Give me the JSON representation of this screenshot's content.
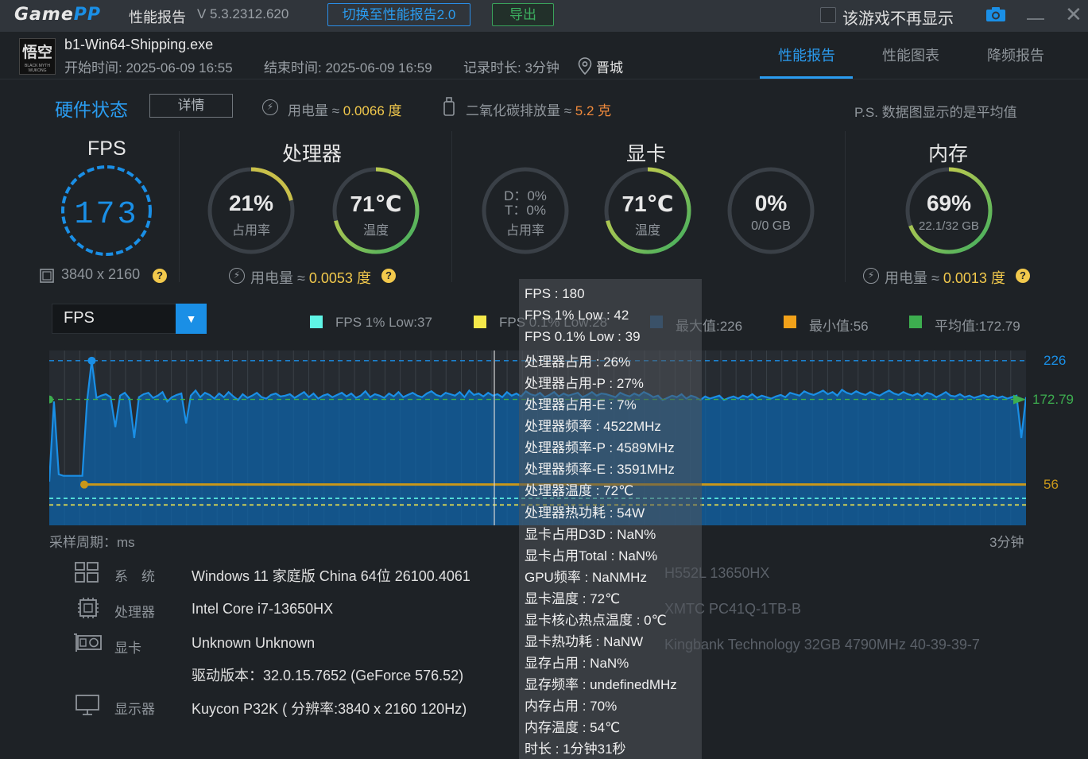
{
  "titlebar": {
    "logo_game": "Game",
    "logo_pp": "PP",
    "title": "性能报告",
    "version": "V 5.3.2312.620",
    "switch_button": "切换至性能报告2.0",
    "export_button": "导出",
    "no_show_label": "该游戏不再显示",
    "close_glyph": "✕"
  },
  "game": {
    "name": "b1-Win64-Shipping.exe",
    "start_time": "开始时间: 2025-06-09 16:55",
    "end_time": "结束时间: 2025-06-09 16:59",
    "duration": "记录时长: 3分钟",
    "city": "晋城",
    "icon_text": "悟空",
    "icon_subtext": "BLACK MYTH WUKONG"
  },
  "tabs": [
    "性能报告",
    "性能图表",
    "降频报告"
  ],
  "hardware": {
    "title": "硬件状态",
    "detail_button": "详情",
    "power_label": "用电量 ≈ ",
    "power_value": "0.0066 度",
    "co2_label": "二氧化碳排放量 ≈ ",
    "co2_value": "5.2 克",
    "ps_note": "P.S. 数据图显示的是平均值",
    "fps": {
      "title": "FPS",
      "value": "173",
      "resolution": "3840 x 2160"
    },
    "cpu": {
      "title": "处理器",
      "usage": "21%",
      "usage_label": "占用率",
      "usage_fraction": 0.21,
      "temp": "71℃",
      "temp_label": "温度",
      "temp_fraction": 0.71,
      "power_label": "用电量 ≈ ",
      "power_value": "0.0053 度"
    },
    "gpu": {
      "title": "显卡",
      "d_usage": "D：0%",
      "t_usage": "T：0%",
      "usage_label": "占用率",
      "temp": "71℃",
      "temp_label": "温度",
      "temp_fraction": 0.71,
      "vram": "0%",
      "vram_label": "0/0 GB"
    },
    "memory": {
      "title": "内存",
      "usage": "69%",
      "usage_label": "22.1/32 GB",
      "usage_fraction": 0.69,
      "power_label": "用电量 ≈ ",
      "power_value": "0.0013 度"
    },
    "help_glyph": "?"
  },
  "chart_panel": {
    "select_value": "FPS",
    "legend": [
      {
        "label": "FPS 1% Low:37",
        "color": "#5ff5e6"
      },
      {
        "label": "FPS 0.1% Low:28",
        "color": "#f5e94a"
      },
      {
        "label": "最大值:226",
        "color": "#1f4f7a"
      },
      {
        "label": "最小值:56",
        "color": "#f2a21a"
      },
      {
        "label": "平均值:172.79",
        "color": "#3dae4f"
      }
    ],
    "x_left_label": "采样周期：ms",
    "x_right_label": "3分钟",
    "max_label": "226",
    "avg_label": "172.79",
    "min_label": "56"
  },
  "chart_data": {
    "type": "area",
    "series": [
      {
        "values": [
          60,
          170,
          70,
          68,
          68,
          68,
          68,
          68,
          170,
          226,
          175,
          178,
          180,
          176,
          135,
          178,
          182,
          174,
          120,
          176,
          180,
          182,
          175,
          178,
          183,
          170,
          176,
          179,
          181,
          140,
          178,
          185,
          176,
          182,
          179,
          174,
          181,
          176,
          183,
          177,
          172,
          180,
          175,
          178,
          182,
          176,
          174,
          179,
          181,
          177,
          178,
          180,
          175,
          179,
          183,
          176,
          181,
          174,
          178,
          180,
          176,
          179,
          182,
          177,
          181,
          175,
          178,
          184,
          176,
          180,
          178,
          175,
          181,
          177,
          183,
          176,
          179,
          182,
          178,
          176,
          181,
          184,
          179,
          177,
          182,
          180,
          178,
          183,
          176,
          185,
          179,
          181,
          177,
          182,
          178,
          180,
          176,
          183,
          178,
          181,
          177,
          184,
          180,
          178,
          182,
          176,
          179,
          183,
          177,
          181,
          178,
          180,
          182,
          176,
          179,
          183,
          178,
          181,
          180,
          178,
          176,
          182,
          179,
          177,
          181,
          178,
          183,
          180,
          176,
          178,
          172,
          175,
          178,
          176,
          180,
          174,
          178,
          176,
          172,
          177,
          174,
          176,
          178,
          172,
          175,
          177,
          174,
          178,
          176,
          180,
          175,
          178,
          176,
          174,
          177,
          179,
          176,
          182,
          180,
          178,
          184,
          181,
          179,
          182,
          185,
          180,
          183,
          178,
          186,
          182,
          180,
          184,
          181,
          179,
          183,
          180,
          178,
          182,
          185,
          181,
          179,
          183,
          180,
          178,
          181,
          177,
          182,
          180,
          176,
          179,
          183,
          178,
          177,
          180,
          176,
          178,
          175,
          177,
          179,
          176,
          178,
          175,
          177,
          174,
          176,
          178,
          120,
          176
        ]
      }
    ],
    "max": 226,
    "min": 56,
    "avg": 172.79,
    "fps_1pct_low": 37,
    "fps_01pct_low": 28,
    "ylim": [
      0,
      240
    ],
    "grid": true
  },
  "tooltip": [
    "FPS : 180",
    "FPS 1% Low : 42",
    "FPS 0.1% Low : 39",
    "处理器占用 : 26%",
    "处理器占用-P : 27%",
    "处理器占用-E : 7%",
    "处理器频率 : 4522MHz",
    "处理器频率-P : 4589MHz",
    "处理器频率-E : 3591MHz",
    "处理器温度 : 72℃",
    "处理器热功耗 : 54W",
    "显卡占用D3D : NaN%",
    "显卡占用Total : NaN%",
    "GPU频率 : NaNMHz",
    "显卡温度 : 72℃",
    "显卡核心热点温度 : 0℃",
    "显卡热功耗 : NaNW",
    "显存占用 : NaN%",
    "显存频率 : undefinedMHz",
    "内存占用 : 70%",
    "内存温度 : 54℃",
    "时长 : 1分钟31秒"
  ],
  "system": {
    "os_label": "系　统",
    "os_value": "Windows 11 家庭版 China 64位 26100.4061",
    "cpu_label": "处理器",
    "cpu_value": "Intel Core i7-13650HX",
    "gpu_label": "显卡",
    "gpu_value": "Unknown Unknown",
    "driver_value": "驱动版本：32.0.15.7652 (GeForce 576.52)",
    "monitor_label": "显示器",
    "monitor_value": "Kuycon P32K ( 分辨率:3840 x 2160 120Hz)",
    "board_value_partial": "H552L 13650HX",
    "disk_value_partial": "XMTC PC41Q-1TB-B",
    "memory_value_partial": "Kingbank Technology 32GB 4790MHz 40-39-39-7"
  }
}
